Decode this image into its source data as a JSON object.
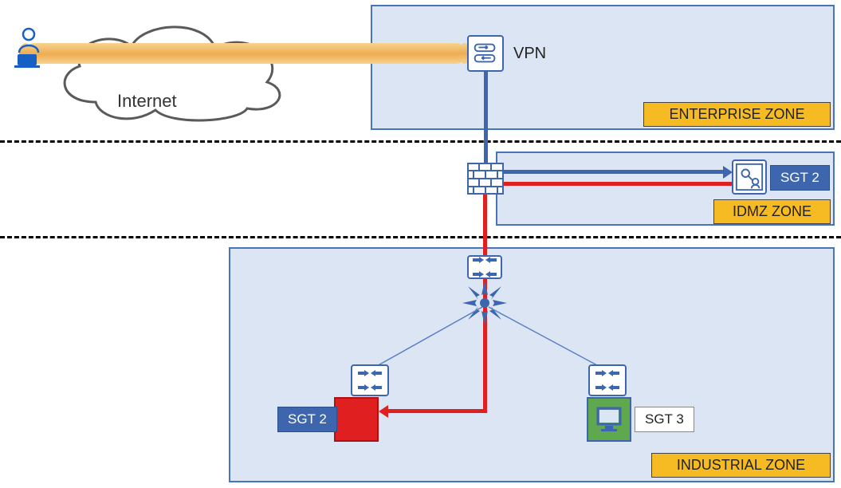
{
  "cloud": {
    "label": "Internet"
  },
  "vpn": {
    "label": "VPN"
  },
  "zones": {
    "enterprise": {
      "label": "ENTERPRISE ZONE"
    },
    "idmz": {
      "label": "IDMZ ZONE"
    },
    "industrial": {
      "label": "INDUSTRIAL ZONE"
    }
  },
  "sgt": {
    "idmz": "SGT 2",
    "left": "SGT 2",
    "right": "SGT 3"
  },
  "chart_data": {
    "type": "diagram",
    "zones": [
      "Enterprise Zone",
      "IDMZ Zone",
      "Industrial Zone"
    ],
    "nodes": [
      {
        "id": "user",
        "type": "remote-user",
        "zone": "Internet"
      },
      {
        "id": "internet",
        "type": "cloud",
        "label": "Internet"
      },
      {
        "id": "vpn",
        "type": "vpn-gateway",
        "zone": "Enterprise Zone",
        "label": "VPN"
      },
      {
        "id": "firewall",
        "type": "firewall",
        "zone": "IDMZ Zone"
      },
      {
        "id": "jump",
        "type": "jump-server",
        "zone": "IDMZ Zone",
        "sgt": "SGT 2"
      },
      {
        "id": "core",
        "type": "core-switch",
        "zone": "Industrial Zone"
      },
      {
        "id": "sw-left",
        "type": "access-switch",
        "zone": "Industrial Zone"
      },
      {
        "id": "sw-right",
        "type": "access-switch",
        "zone": "Industrial Zone"
      },
      {
        "id": "asset-left",
        "type": "endpoint",
        "sgt": "SGT 2",
        "zone": "Industrial Zone",
        "color": "red"
      },
      {
        "id": "asset-right",
        "type": "workstation",
        "sgt": "SGT 3",
        "zone": "Industrial Zone",
        "color": "green"
      }
    ],
    "edges": [
      {
        "from": "user",
        "to": "vpn",
        "style": "vpn-tunnel"
      },
      {
        "from": "vpn",
        "to": "firewall",
        "style": "blue"
      },
      {
        "from": "firewall",
        "to": "jump",
        "style": "blue-arrow"
      },
      {
        "from": "firewall",
        "to": "jump",
        "style": "red"
      },
      {
        "from": "firewall",
        "to": "core",
        "style": "red"
      },
      {
        "from": "core",
        "to": "sw-left",
        "style": "thin"
      },
      {
        "from": "core",
        "to": "sw-right",
        "style": "thin"
      },
      {
        "from": "core",
        "to": "asset-left",
        "style": "red-arrow"
      },
      {
        "from": "sw-left",
        "to": "asset-left",
        "style": "thin"
      },
      {
        "from": "sw-right",
        "to": "asset-right",
        "style": "thin"
      }
    ]
  }
}
